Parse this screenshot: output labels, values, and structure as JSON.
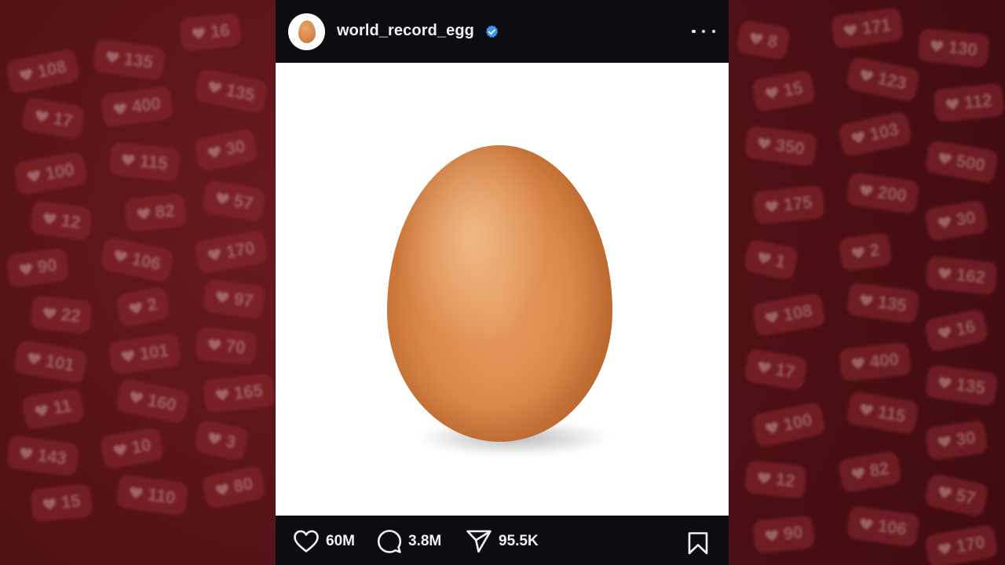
{
  "background": {
    "bubbles": [
      "108",
      "135",
      "16",
      "17",
      "400",
      "135",
      "100",
      "115",
      "30",
      "12",
      "82",
      "57",
      "90",
      "106",
      "170",
      "22",
      "2",
      "97",
      "101",
      "101",
      "70",
      "11",
      "160",
      "165",
      "143",
      "10",
      "3",
      "15",
      "110",
      "80",
      "8",
      "171",
      "130",
      "15",
      "123",
      "112",
      "350",
      "103",
      "500",
      "175",
      "200",
      "30",
      "1",
      "2",
      "162"
    ]
  },
  "post": {
    "username": "world_record_egg",
    "verified": true,
    "more_icon": "more-horizontal-icon",
    "image_alt": "egg photo"
  },
  "stats": {
    "likes": "60M",
    "comments": "3.8M",
    "shares": "95.5K"
  },
  "icons": {
    "like": "heart-icon",
    "comment": "comment-icon",
    "share": "paper-plane-icon",
    "save": "bookmark-icon"
  },
  "colors": {
    "card_bg": "#0b0d11",
    "background": "#5a1418",
    "verified_blue": "#3897f0",
    "egg": "#dc8a4c"
  }
}
